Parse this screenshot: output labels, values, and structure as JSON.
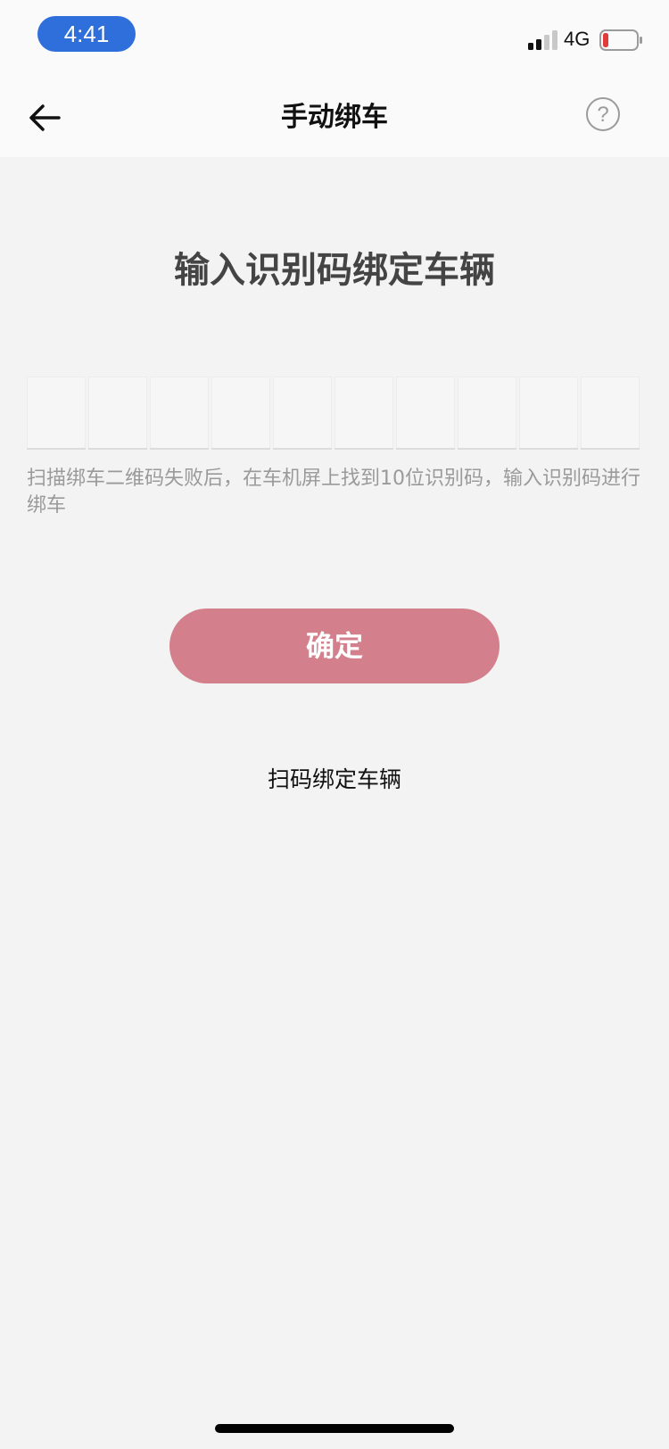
{
  "status_bar": {
    "time": "4:41",
    "network": "4G",
    "icons": [
      "signal-icon",
      "battery-icon"
    ],
    "colors": {
      "time_pill": "#2f6fdc",
      "battery_low": "#e23b3b"
    }
  },
  "nav": {
    "title": "手动绑车",
    "back_icon": "arrow-left-icon",
    "help_icon": "question-circle-icon",
    "help_label": "?"
  },
  "main": {
    "title": "输入识别码绑定车辆",
    "code_length": 10,
    "code_values": [
      "",
      "",
      "",
      "",
      "",
      "",
      "",
      "",
      "",
      ""
    ],
    "hint": "扫描绑车二维码失败后，在车机屏上找到10位识别码，输入识别码进行绑车",
    "confirm_label": "确定",
    "scan_label": "扫码绑定车辆"
  },
  "colors": {
    "background": "#f3f3f3",
    "accent_button": "#d4808c"
  }
}
